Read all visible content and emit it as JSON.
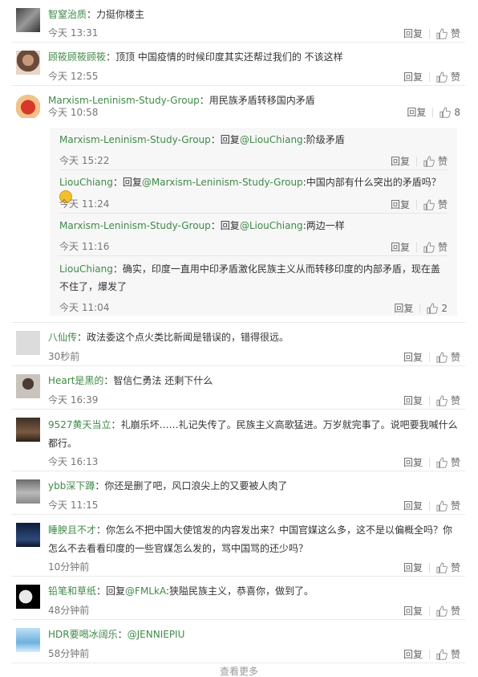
{
  "actions": {
    "reply": "回复",
    "like": "赞"
  },
  "comments": [
    {
      "user": "智窒治质",
      "text": "力挺你楼主",
      "time": "今天 13:31",
      "likes": "赞"
    },
    {
      "user": "顾筱顾筱顾筱",
      "text": "顶顶 中国疫情的时候印度其实还帮过我们的 不该这样",
      "time": "今天 12:55",
      "likes": "赞"
    },
    {
      "user": "Marxism-Leninism-Study-Group",
      "text": "用民族矛盾转移国内矛盾",
      "time": "今天 10:58",
      "likes": "8"
    },
    {
      "user": "八仙传",
      "text": "政法委这个点火类比新闻是错误的，错得很远。",
      "time": "30秒前",
      "likes": "赞"
    },
    {
      "user": "Heart是黑的",
      "text": "智信仁勇法 还剩下什么",
      "time": "今天 16:39",
      "likes": "赞"
    },
    {
      "user": "9527黄天当立",
      "text": "礼崩乐坏……礼记失传了。民族主义高歌猛进。万岁就完事了。说吧要我喊什么都行。",
      "time": "今天 16:13",
      "likes": "赞"
    },
    {
      "user": "ybb深下蹲",
      "text": "你还是删了吧，风口浪尖上的又要被人肉了",
      "time": "今天 11:15",
      "likes": "赞"
    },
    {
      "user": "睡腴且不才",
      "text": "你怎么不把中国大使馆发的内容发出来？中国官媒这么多，这不是以偏概全吗？你怎么不去看看印度的一些官媒怎么发的，骂中国骂的还少吗？",
      "time": "10分钟前",
      "likes": "赞"
    },
    {
      "user": "铅笔和草纸",
      "text": "狭隘民族主义，恭喜你，做到了。",
      "mention": "@FMLkA",
      "time": "48分钟前",
      "likes": "赞"
    },
    {
      "user": "HDR要喝冰阔乐",
      "text": "",
      "mention": "@JENNIEPIU",
      "time": "58分钟前",
      "likes": "赞"
    }
  ],
  "replies": [
    {
      "user": "Marxism-Leninism-Study-Group",
      "mention": "@LiouChiang",
      "text": "阶级矛盾",
      "time": "今天 15:22",
      "likes": "赞"
    },
    {
      "user": "LiouChiang",
      "mention": "@Marxism-Leninism-Study-Group",
      "text": "中国内部有什么突出的矛盾吗？",
      "time": "今天 11:24",
      "likes": "赞"
    },
    {
      "user": "Marxism-Leninism-Study-Group",
      "mention": "@LiouChiang",
      "text": "两边一样",
      "time": "今天 11:16",
      "likes": "赞"
    },
    {
      "user": "LiouChiang",
      "text": "确实，印度一直用中印矛盾激化民族主义从而转移印度的内部矛盾，现在盖不住了，爆发了",
      "time": "今天 11:04",
      "likes": "2"
    }
  ],
  "reply_prefix": "回复",
  "colon": "：",
  "load_more": "查看更多"
}
